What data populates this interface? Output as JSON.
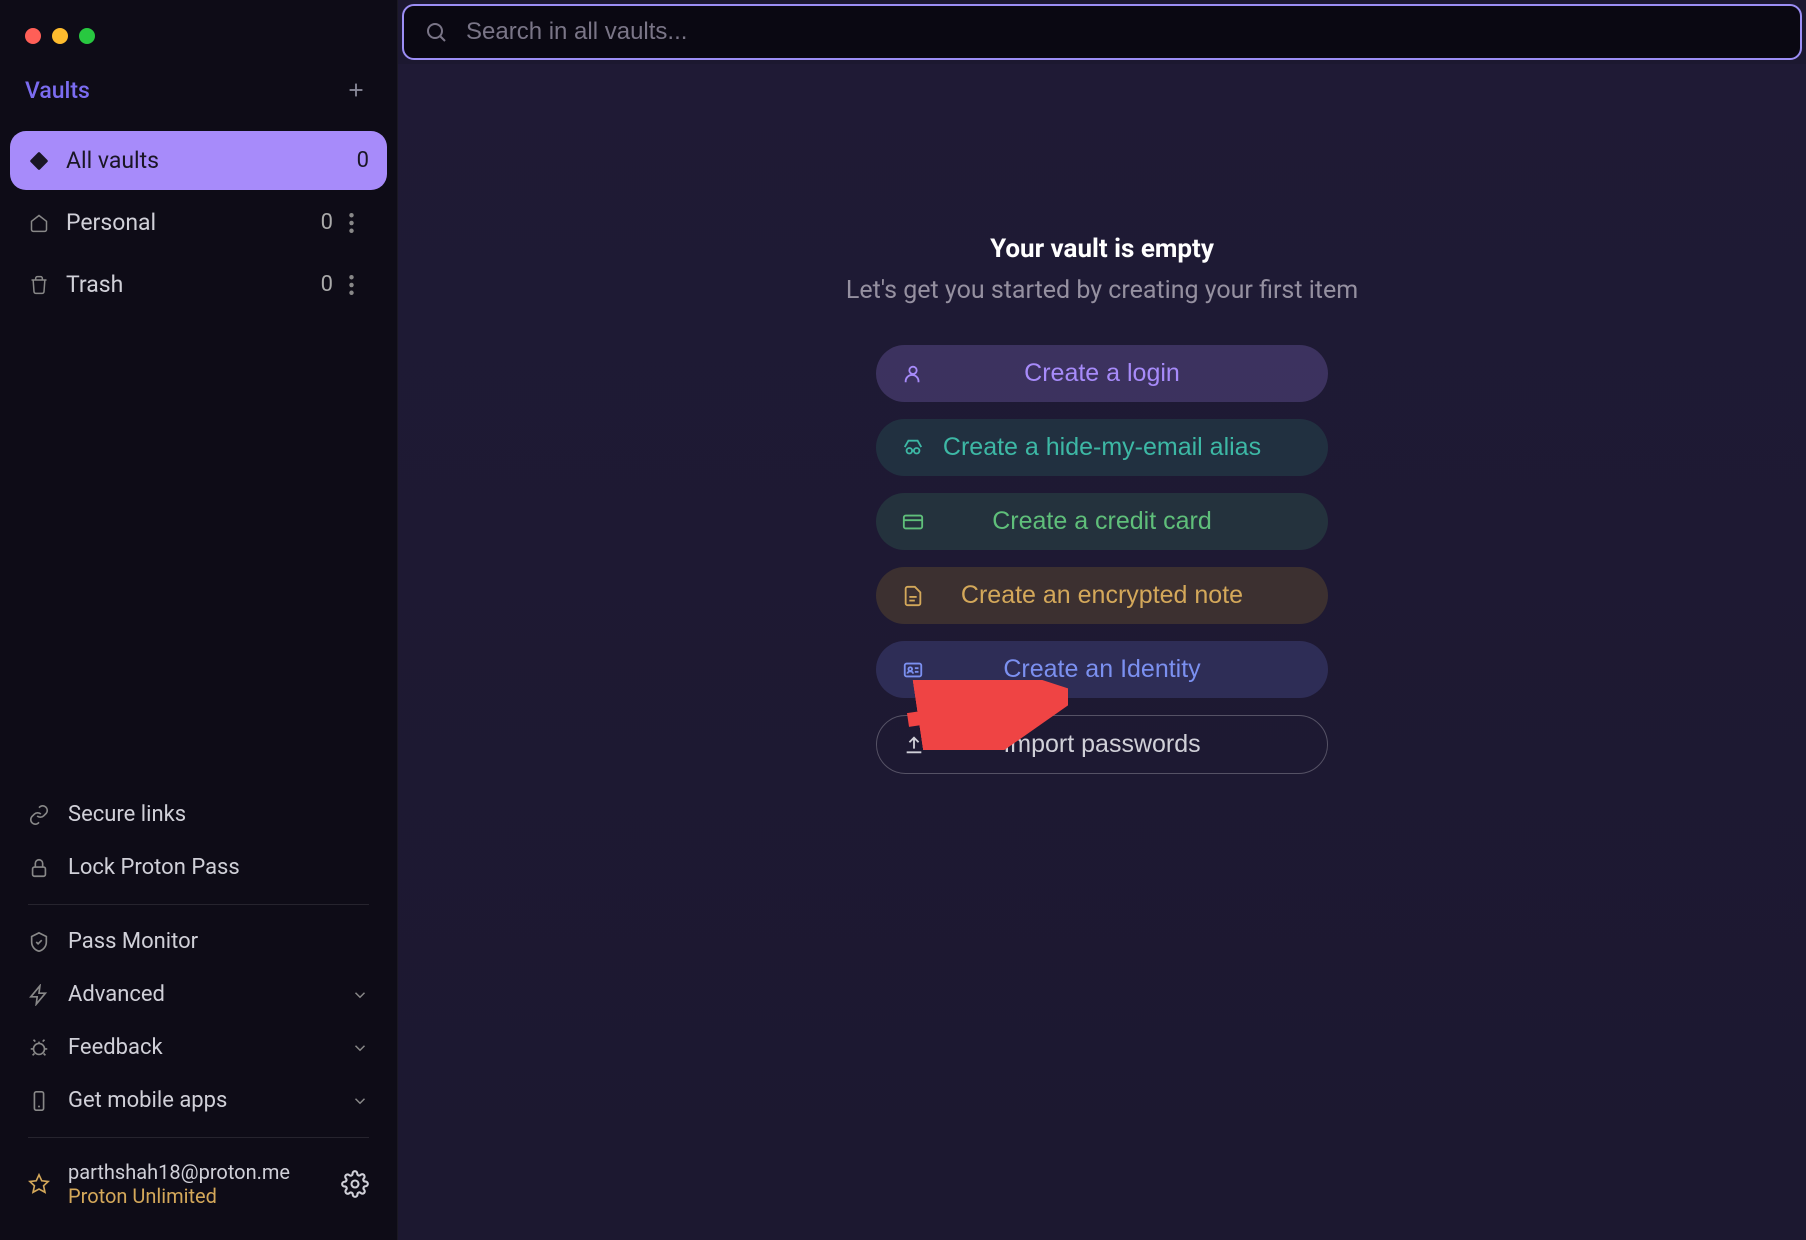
{
  "sidebar": {
    "title": "Vaults",
    "vaults": [
      {
        "label": "All vaults",
        "count": "0",
        "selected": true,
        "more": false
      },
      {
        "label": "Personal",
        "count": "0",
        "selected": false,
        "more": true
      },
      {
        "label": "Trash",
        "count": "0",
        "selected": false,
        "more": true
      }
    ],
    "nav_top": [
      {
        "label": "Secure links"
      },
      {
        "label": "Lock Proton Pass"
      }
    ],
    "nav_bottom": [
      {
        "label": "Pass Monitor",
        "chevron": false
      },
      {
        "label": "Advanced",
        "chevron": true
      },
      {
        "label": "Feedback",
        "chevron": true
      },
      {
        "label": "Get mobile apps",
        "chevron": true
      }
    ],
    "account": {
      "email": "parthshah18@proton.me",
      "plan": "Proton Unlimited"
    }
  },
  "search": {
    "placeholder": "Search in all vaults..."
  },
  "main": {
    "empty_title": "Your vault is empty",
    "empty_subtitle": "Let's get you started by creating your first item",
    "actions": {
      "login": "Create a login",
      "alias": "Create a hide-my-email alias",
      "card": "Create a credit card",
      "note": "Create an encrypted note",
      "identity": "Create an Identity",
      "import": "Import passwords"
    }
  }
}
